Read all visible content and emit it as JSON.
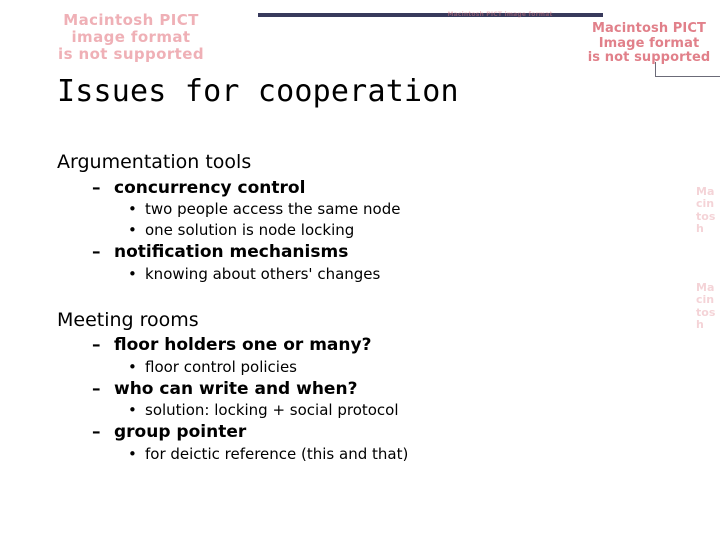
{
  "slide": {
    "title": "Issues for cooperation",
    "bullet_dash": "–",
    "bullet_dot": "•",
    "colors": {
      "rule": "#383a5c",
      "placeholder_text": "#e07a84",
      "body_text": "#000000",
      "background": "#ffffff"
    },
    "sections": [
      {
        "heading": "Argumentation tools",
        "items": [
          {
            "label": "concurrency control",
            "subitems": [
              "two people access the same node",
              "one solution is node locking"
            ]
          },
          {
            "label": "notification mechanisms",
            "subitems": [
              "knowing about others' changes"
            ]
          }
        ]
      },
      {
        "heading": "Meeting rooms",
        "items": [
          {
            "label": "floor holders one or many?",
            "subitems": [
              "floor control policies"
            ]
          },
          {
            "label": "who can write and when?",
            "subitems": [
              "solution: locking + social protocol"
            ]
          },
          {
            "label": "group pointer",
            "subitems": [
              "for deictic reference (this and that)"
            ]
          }
        ]
      }
    ]
  },
  "placeholders": {
    "top_left": "Macintosh PICT\nimage format\nis not supported",
    "top_right": "Macintosh PICT\nImage format\nis not supported",
    "mid_rule": "Macintosh PICT image format",
    "edge_a": "Ma\ncin\ntos\nh",
    "edge_b": "Ma\ncin\ntos\nh"
  }
}
